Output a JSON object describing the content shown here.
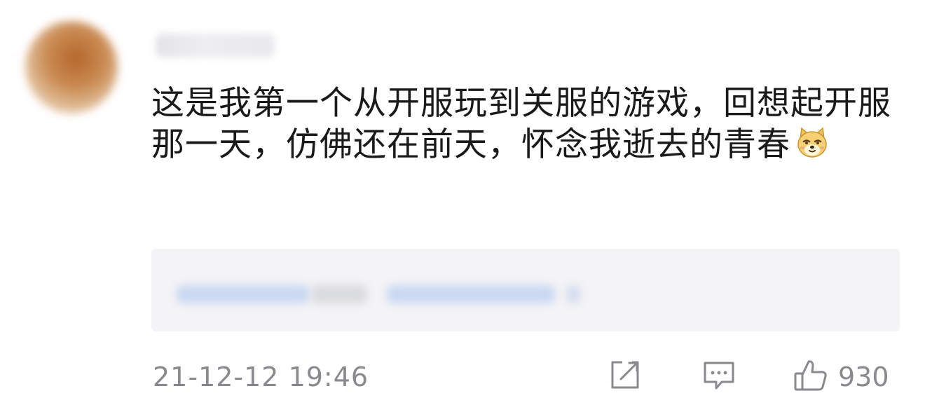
{
  "comment": {
    "text": "这是我第一个从开服玩到关服的游戏，回想起开服那一天，仿佛还在前天，怀念我逝去的青春",
    "emoji": "doge-emoji"
  },
  "footer": {
    "timestamp": "21-12-12 19:46",
    "like_count": "930",
    "icons": [
      "share-icon",
      "comment-icon",
      "thumbs-up-icon"
    ]
  },
  "colors": {
    "text": "#1a1a1a",
    "meta": "#8a8a8e",
    "reply_bg": "#f4f4f6",
    "reply_link": "#c9d8f0"
  }
}
